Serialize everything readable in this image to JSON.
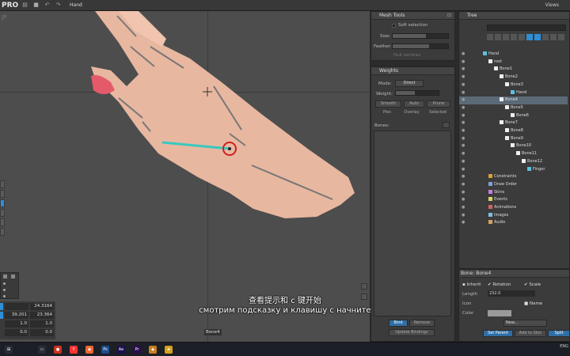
{
  "app": {
    "logo": "PRO",
    "project_name": "Hand",
    "views_label": "Views"
  },
  "viewport": {
    "corner_label": "JP",
    "bone_tooltip": "Bone4"
  },
  "transform": {
    "rows": [
      {
        "a": "",
        "b": "24.3164"
      },
      {
        "a": "39.201",
        "b": "23.364"
      },
      {
        "a": "1.0",
        "b": "1.0"
      },
      {
        "a": "0.0",
        "b": "0.0"
      }
    ]
  },
  "subtitles": {
    "chinese": "查看提示和 c 键开始",
    "russian": "смотрим подсказку и клавишу с начните"
  },
  "mesh_tools": {
    "title": "Mesh Tools",
    "soft_selection": "Soft selection",
    "size_label": "Size:",
    "feather_label": "Feather:",
    "hull_vertices": "Hull vertices",
    "size_value": 0.6,
    "feather_value": 0.65
  },
  "weights": {
    "title": "Weights",
    "mode_label": "Mode:",
    "mode_value": "Direct",
    "weight_label": "Weight:",
    "weight_value": 0.45,
    "buttons": {
      "smooth": "Smooth",
      "auto": "Auto",
      "prune": "Prune",
      "pies": "Pies",
      "overlay": "Overlay",
      "selected": "Selected"
    },
    "bones_label": "Bones:",
    "bind": "Bind",
    "remove": "Remove",
    "update_bindings": "Update Bindings"
  },
  "tree": {
    "title": "Tree",
    "items": [
      {
        "label": "Hand",
        "indent": 0,
        "icon": "skeleton"
      },
      {
        "label": "root",
        "indent": 1,
        "icon": "bone"
      },
      {
        "label": "Bone1",
        "indent": 2,
        "icon": "bone"
      },
      {
        "label": "Bone2",
        "indent": 3,
        "icon": "bone"
      },
      {
        "label": "Bone3",
        "indent": 4,
        "icon": "bone"
      },
      {
        "label": "Hand",
        "indent": 5,
        "icon": "mesh"
      },
      {
        "label": "Bone4",
        "indent": 3,
        "icon": "bone",
        "selected": true
      },
      {
        "label": "Bone5",
        "indent": 4,
        "icon": "bone"
      },
      {
        "label": "Bone6",
        "indent": 5,
        "icon": "bone"
      },
      {
        "label": "Bone7",
        "indent": 3,
        "icon": "bone"
      },
      {
        "label": "Bone8",
        "indent": 4,
        "icon": "bone"
      },
      {
        "label": "Bone9",
        "indent": 4,
        "icon": "bone"
      },
      {
        "label": "Bone10",
        "indent": 5,
        "icon": "bone"
      },
      {
        "label": "Bone11",
        "indent": 6,
        "icon": "bone"
      },
      {
        "label": "Bone12",
        "indent": 7,
        "icon": "bone"
      },
      {
        "label": "Finger",
        "indent": 8,
        "icon": "mesh"
      },
      {
        "label": "Constraints",
        "indent": 1,
        "icon": "constraint"
      },
      {
        "label": "Draw Order",
        "indent": 1,
        "icon": "draworder"
      },
      {
        "label": "Skins",
        "indent": 1,
        "icon": "skin"
      },
      {
        "label": "Events",
        "indent": 1,
        "icon": "event"
      },
      {
        "label": "Animations",
        "indent": 1,
        "icon": "animation"
      },
      {
        "label": "Images",
        "indent": 1,
        "icon": "image"
      },
      {
        "label": "Audio",
        "indent": 1,
        "icon": "audio"
      }
    ]
  },
  "bone_props": {
    "title": "Bone: Bone4",
    "inherit": "Inherit",
    "rotation": "Rotation",
    "scale": "Scale",
    "length_label": "Length",
    "length_value": "232.0",
    "icon_label": "Icon",
    "name_label": "Name",
    "color_label": "Color",
    "new_label": "New...",
    "set_parent": "Set Parent",
    "add_to_skin": "Add to Skin",
    "split": "Split"
  },
  "taskbar": {
    "lang": "ENG"
  },
  "colors": {
    "accent": "#2f8fd6",
    "selection_row": "#5c6a78",
    "bone_highlight": "#37c9c0",
    "bone_ring": "#d21f1f"
  }
}
